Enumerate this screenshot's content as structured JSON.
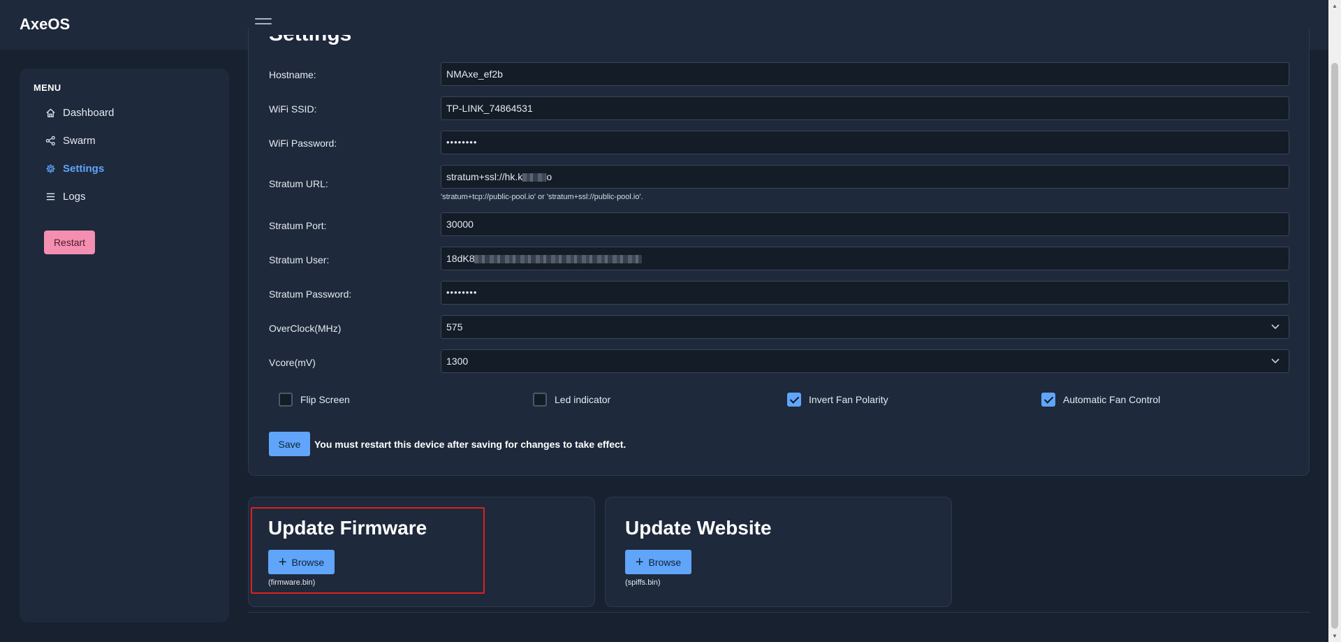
{
  "app": {
    "brand": "AxeOS"
  },
  "sidebar": {
    "menu_title": "MENU",
    "items": [
      {
        "label": "Dashboard",
        "icon": "home-icon",
        "active": false
      },
      {
        "label": "Swarm",
        "icon": "share-icon",
        "active": false
      },
      {
        "label": "Settings",
        "icon": "gear-icon",
        "active": true
      },
      {
        "label": "Logs",
        "icon": "list-icon",
        "active": false
      }
    ],
    "restart_label": "Restart"
  },
  "settings": {
    "heading": "Settings",
    "fields": {
      "hostname": {
        "label": "Hostname:",
        "value": "NMAxe_ef2b"
      },
      "wifi_ssid": {
        "label": "WiFi SSID:",
        "value": "TP-LINK_74864531"
      },
      "wifi_password": {
        "label": "WiFi Password:",
        "value": "••••••••"
      },
      "stratum_url": {
        "label": "Stratum URL:",
        "value": "stratum+ssl://hk.k",
        "value_tail": "o",
        "hint": "'stratum+tcp://public-pool.io' or 'stratum+ssl://public-pool.io'."
      },
      "stratum_port": {
        "label": "Stratum Port:",
        "value": "30000"
      },
      "stratum_user": {
        "label": "Stratum User:",
        "value": "18dK8"
      },
      "stratum_password": {
        "label": "Stratum Password:",
        "value": "••••••••"
      },
      "overclock": {
        "label": "OverClock(MHz)",
        "value": "575"
      },
      "vcore": {
        "label": "Vcore(mV)",
        "value": "1300"
      }
    },
    "checkboxes": {
      "flip_screen": {
        "label": "Flip Screen",
        "checked": false
      },
      "led_indicator": {
        "label": "Led indicator",
        "checked": false
      },
      "invert_fan": {
        "label": "Invert Fan Polarity",
        "checked": true
      },
      "auto_fan": {
        "label": "Automatic Fan Control",
        "checked": true
      }
    },
    "save_label": "Save",
    "save_note": "You must restart this device after saving for changes to take effect."
  },
  "update_firmware": {
    "title": "Update Firmware",
    "browse_label": "Browse",
    "file": "(firmware.bin)"
  },
  "update_website": {
    "title": "Update Website",
    "browse_label": "Browse",
    "file": "(spiffs.bin)"
  },
  "colors": {
    "accent": "#60a5fa",
    "restart": "#f48fb1",
    "highlight": "#e02020",
    "background": "#17212f",
    "panel": "#1e293b"
  }
}
